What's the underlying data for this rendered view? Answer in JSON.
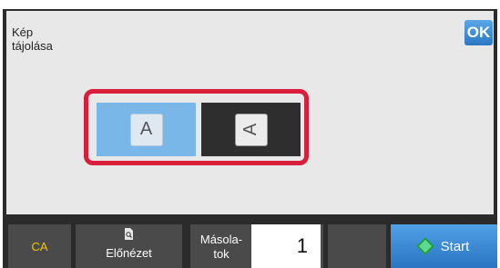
{
  "header": {
    "title": "Kép\ntájolása",
    "ok_label": "OK"
  },
  "orientation": {
    "options": [
      {
        "glyph": "A",
        "selected": true
      },
      {
        "glyph": "A",
        "selected": false
      }
    ]
  },
  "bottom_bar": {
    "ca_label": "CA",
    "preview_label": "Előnézet",
    "copies_label": "Másola-\ntok",
    "copies_value": "1",
    "start_label": "Start"
  },
  "colors": {
    "accent_blue": "#2a78c4",
    "selection_red": "#d91e3c",
    "ca_yellow": "#f2c400",
    "start_green": "#5fd98d"
  },
  "icons": [
    "preview-icon",
    "start-icon"
  ]
}
